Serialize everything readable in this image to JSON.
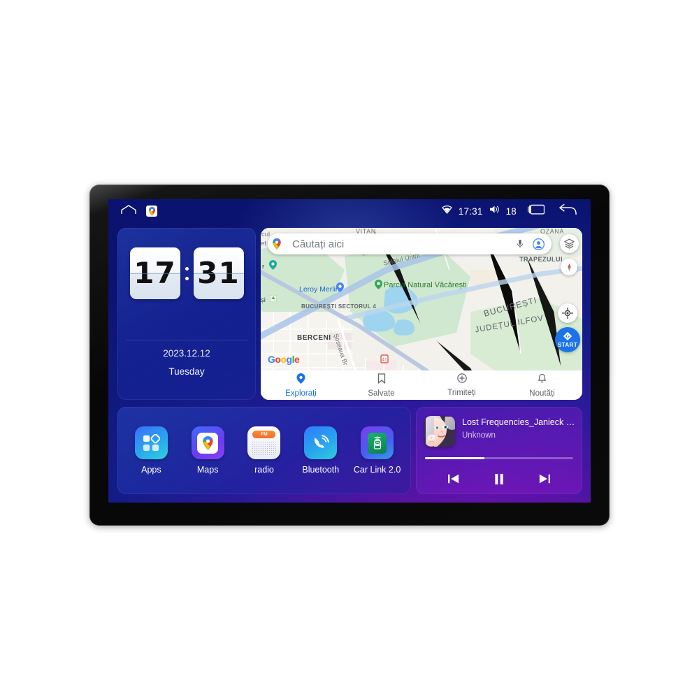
{
  "device": {
    "type": "car-head-unit-touchscreen"
  },
  "statusbar": {
    "home_icon": "home-icon",
    "maps_icon": "google-maps-icon",
    "wifi_icon": "wifi-icon",
    "time": "17:31",
    "volume_icon": "volume-icon",
    "volume_level": "18",
    "recents_icon": "recents-icon",
    "back_icon": "back-icon"
  },
  "clock_widget": {
    "hours": "17",
    "minutes": "31",
    "date": "2023.12.12",
    "weekday": "Tuesday"
  },
  "map_widget": {
    "search": {
      "placeholder": "Căutați aici",
      "pin_icon": "google-maps-pin-icon",
      "mic_icon": "microphone-icon",
      "account_icon": "account-avatar-icon"
    },
    "layers_icon": "layers-icon",
    "compass_icon": "compass-icon",
    "locate_icon": "my-location-icon",
    "start_button": {
      "label": "START",
      "icon": "navigation-arrow-icon"
    },
    "watermark": "Google",
    "labels": [
      {
        "text": "VITAN",
        "type": "district"
      },
      {
        "text": "OZANA",
        "type": "district"
      },
      {
        "text": "TRAPEZULUI",
        "type": "district"
      },
      {
        "text": "BUCUREȘTI",
        "type": "city"
      },
      {
        "text": "JUDEȚUL ILFOV",
        "type": "county"
      },
      {
        "text": "BUCUREȘTI SECTORUL 4",
        "type": "sector"
      },
      {
        "text": "BERCENI",
        "type": "district"
      },
      {
        "text": "Parcul Natural Văcărești",
        "type": "park"
      },
      {
        "text": "Leroy Merlin",
        "type": "poi"
      },
      {
        "text": "Splaiul Unirii",
        "type": "road"
      },
      {
        "text": "Șoseaua Br",
        "type": "road"
      },
      {
        "text": "Unirii",
        "type": "road"
      },
      {
        "text": "cul",
        "type": "clipped"
      },
      {
        "text": "et",
        "type": "clipped"
      },
      {
        "text": "și",
        "type": "clipped"
      },
      {
        "text": "r",
        "type": "clipped"
      }
    ],
    "bottom_nav": [
      {
        "label": "Explorați",
        "icon": "explore-pin-icon",
        "active": true
      },
      {
        "label": "Salvate",
        "icon": "bookmark-icon",
        "active": false
      },
      {
        "label": "Trimiteți",
        "icon": "contribute-plus-icon",
        "active": false
      },
      {
        "label": "Noutăți",
        "icon": "bell-icon",
        "active": false
      }
    ]
  },
  "dock": {
    "apps": [
      {
        "label": "Apps",
        "icon": "apps-grid-icon"
      },
      {
        "label": "Maps",
        "icon": "google-maps-icon"
      },
      {
        "label": "radio",
        "icon": "fm-radio-icon",
        "badge": "FM"
      },
      {
        "label": "Bluetooth",
        "icon": "bluetooth-phone-icon"
      },
      {
        "label": "Car Link 2.0",
        "icon": "car-link-icon"
      }
    ]
  },
  "media": {
    "album_art": "album-art-woman-portrait",
    "title": "Lost Frequencies_Janieck Devy-...",
    "artist": "Unknown",
    "progress_percent": 40,
    "controls": [
      {
        "name": "previous",
        "icon": "skip-previous-icon"
      },
      {
        "name": "pause",
        "icon": "pause-icon"
      },
      {
        "name": "next",
        "icon": "skip-next-icon"
      }
    ]
  },
  "colors": {
    "accent_blue": "#1a73e8",
    "screen_blue": "#131c87",
    "screen_purple": "#7b17b8",
    "fm_orange": "#ef6f28"
  }
}
